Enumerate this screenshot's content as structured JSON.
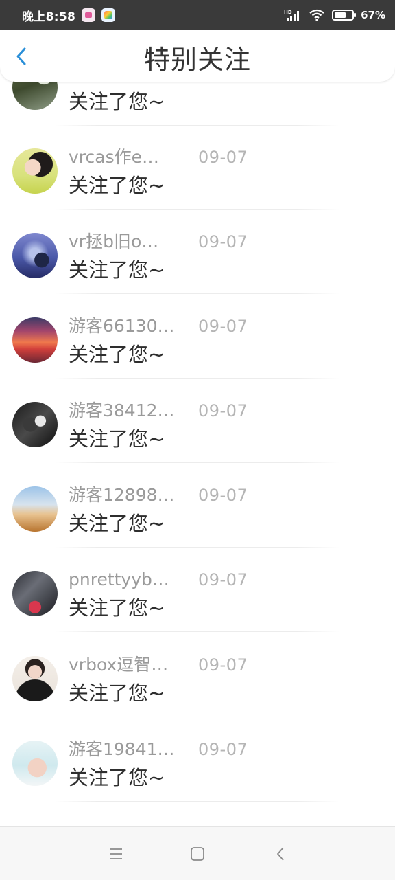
{
  "status_bar": {
    "time": "晚上8:58",
    "network_label": "HD",
    "battery_percent": "67%",
    "battery_level": 0.67
  },
  "header": {
    "title": "特别关注",
    "back_icon": "chevron-left-icon"
  },
  "items": [
    {
      "name": "",
      "date": "",
      "message": "关注了您~",
      "avatar": "avatar-photo"
    },
    {
      "name": "vrcas作e…",
      "date": "09-07",
      "message": "关注了您~",
      "avatar": "avatar-photo"
    },
    {
      "name": "vr拯b旧o…",
      "date": "09-07",
      "message": "关注了您~",
      "avatar": "avatar-photo"
    },
    {
      "name": "游客66130…",
      "date": "09-07",
      "message": "关注了您~",
      "avatar": "avatar-photo"
    },
    {
      "name": "游客38412…",
      "date": "09-07",
      "message": "关注了您~",
      "avatar": "avatar-photo"
    },
    {
      "name": "游客12898…",
      "date": "09-07",
      "message": "关注了您~",
      "avatar": "avatar-photo"
    },
    {
      "name": "pnrettyyb…",
      "date": "09-07",
      "message": "关注了您~",
      "avatar": "avatar-photo"
    },
    {
      "name": "vrbox逗智…",
      "date": "09-07",
      "message": "关注了您~",
      "avatar": "avatar-photo"
    },
    {
      "name": "游客19841…",
      "date": "09-07",
      "message": "关注了您~",
      "avatar": "avatar-photo"
    }
  ],
  "nav": {
    "menu_icon": "menu-icon",
    "home_icon": "square-home-icon",
    "back_icon": "nav-back-icon"
  }
}
